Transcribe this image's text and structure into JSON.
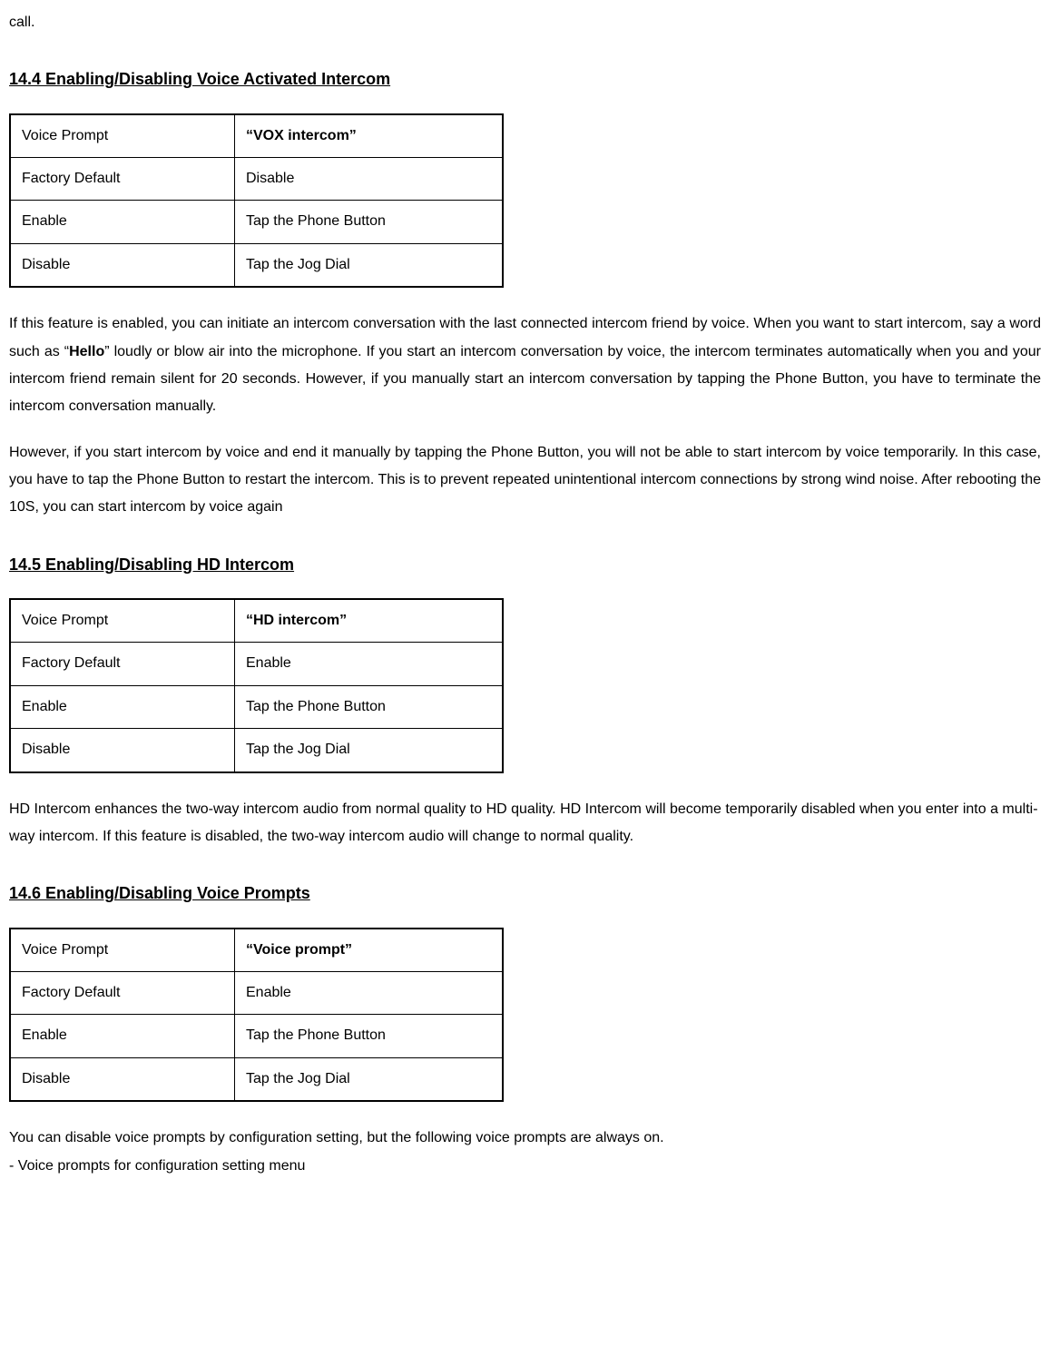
{
  "intro_fragment": "call.",
  "sections": {
    "s144": {
      "heading": "14.4 Enabling/Disabling Voice Activated Intercom",
      "table": {
        "r0c0": "Voice Prompt",
        "r0c1": "“VOX intercom”",
        "r1c0": "Factory Default",
        "r1c1": "Disable",
        "r2c0": "Enable",
        "r2c1": "Tap the Phone Button",
        "r3c0": "Disable",
        "r3c1": "Tap the Jog Dial"
      },
      "para1_a": "If this feature is enabled, you can initiate an intercom conversation with the last connected intercom friend by voice. When you want to start intercom, say a word such as “",
      "para1_b": "Hello",
      "para1_c": "” loudly or blow air into the microphone. If you start an intercom conversation by voice, the intercom terminates automatically when you and your intercom friend remain silent for 20 seconds. However, if you manually start an intercom conversation by tapping the Phone Button, you have to terminate the intercom conversation manually.",
      "para2": "However, if you start intercom by voice and end it manually by tapping the Phone Button, you will not be able to start intercom by voice temporarily. In this case, you have to tap the Phone Button to restart the intercom. This is to prevent repeated unintentional intercom connections by strong wind noise. After rebooting the 10S, you can start intercom by voice again"
    },
    "s145": {
      "heading": "14.5 Enabling/Disabling HD Intercom",
      "table": {
        "r0c0": "Voice Prompt",
        "r0c1": "“HD intercom”",
        "r1c0": "Factory Default",
        "r1c1": "Enable",
        "r2c0": "Enable",
        "r2c1": "Tap the Phone Button",
        "r3c0": "Disable",
        "r3c1": "Tap the Jog Dial"
      },
      "para1": "HD Intercom enhances the two-way intercom audio from normal quality to HD quality. HD Intercom will become temporarily disabled when you enter into a multi-way intercom. If this feature is disabled, the two-way intercom audio will change to normal quality."
    },
    "s146": {
      "heading": "14.6 Enabling/Disabling Voice Prompts",
      "table": {
        "r0c0": "Voice Prompt",
        "r0c1": "“Voice prompt”",
        "r1c0": "Factory Default",
        "r1c1": "Enable",
        "r2c0": "Enable",
        "r2c1": "Tap the Phone Button",
        "r3c0": "Disable",
        "r3c1": "Tap the Jog Dial"
      },
      "para1": "You can disable voice prompts by configuration setting, but the following voice prompts are always on.",
      "para2": "- Voice prompts for configuration setting menu"
    }
  }
}
